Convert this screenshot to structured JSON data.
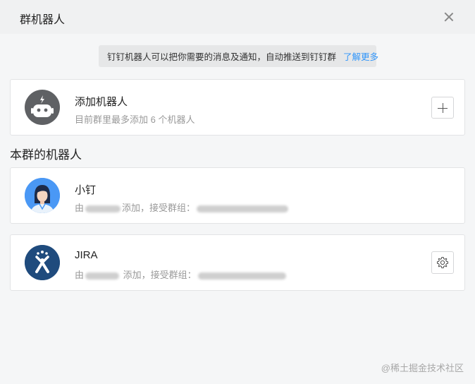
{
  "header": {
    "title": "群机器人"
  },
  "notice": {
    "text": "钉钉机器人可以把你需要的消息及通知，自动推送到钉钉群",
    "link": "了解更多"
  },
  "add_robot": {
    "title": "添加机器人",
    "subtitle": "目前群里最多添加 6 个机器人"
  },
  "section": {
    "title": "本群的机器人"
  },
  "robots": [
    {
      "name": "小钉",
      "prefix": "由",
      "added": "添加，接受群组：",
      "icon": "dingtalk-assistant-avatar"
    },
    {
      "name": "JIRA",
      "prefix": "由",
      "added": " 添加，接受群组：",
      "icon": "jira-avatar"
    }
  ],
  "watermark": "@稀土掘金技术社区",
  "colors": {
    "accent": "#3296fa",
    "robot_icon_bg": "#5f6164",
    "jira_bg": "#1f4b7d"
  }
}
